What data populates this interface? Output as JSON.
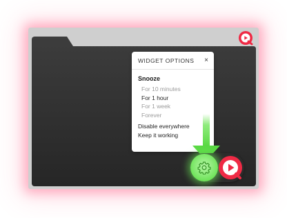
{
  "widget_panel": {
    "title": "WIDGET OPTIONS",
    "close_glyph": "×",
    "snooze_heading": "Snooze",
    "snooze_options": [
      {
        "label": "For 10 minutes",
        "active": false
      },
      {
        "label": "For 1 hour",
        "active": true
      },
      {
        "label": "For 1 week",
        "active": false
      },
      {
        "label": "Forever",
        "active": false
      }
    ],
    "disable_everywhere": "Disable everywhere",
    "keep_working": "Keep it working"
  },
  "icons": {
    "gear": "gear-icon",
    "play_logo": "play-logo-icon",
    "arrow": "arrow-down-icon"
  },
  "colors": {
    "brand_red": "#ef2a45",
    "highlight_green": "#6fe35a",
    "folder_dark": "#333333"
  }
}
